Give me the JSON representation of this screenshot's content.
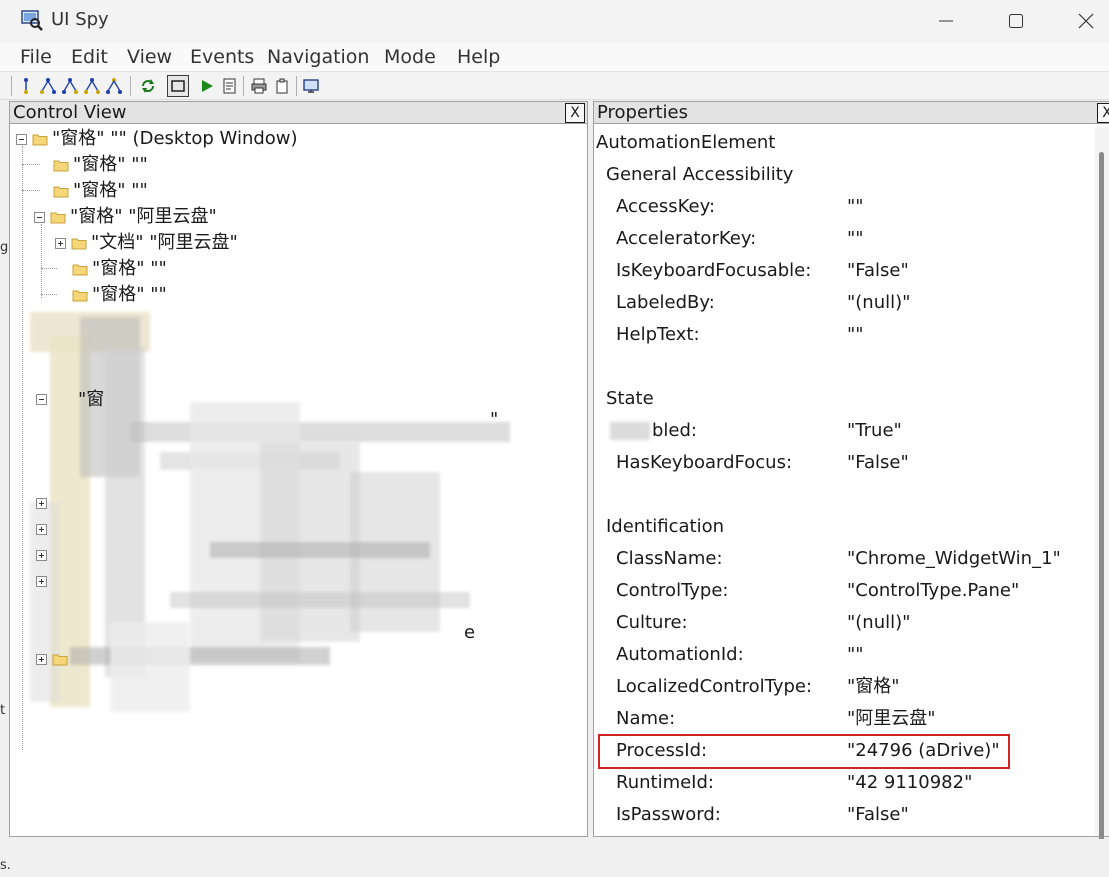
{
  "window": {
    "title": "UI Spy"
  },
  "menu": [
    "File",
    "Edit",
    "View",
    "Events",
    "Navigation",
    "Mode",
    "Help"
  ],
  "left_pane": {
    "title": "Control View",
    "close": "X",
    "tree": [
      {
        "text": "\"窗格\" \"\" (Desktop Window)"
      },
      {
        "text": "\"窗格\" \"\""
      },
      {
        "text": "\"窗格\" \"\""
      },
      {
        "text": "\"窗格\" \"阿里云盘\""
      },
      {
        "text": "\"文档\" \"阿里云盘\""
      },
      {
        "text": "\"窗格\" \"\""
      },
      {
        "text": "\"窗格\" \"\""
      }
    ],
    "obscured_fragment": "\"窗",
    "obscured_fragment2": "\"",
    "obscured_fragment3": "e"
  },
  "right_pane": {
    "title": "Properties",
    "close": "X",
    "root": "AutomationElement",
    "groups": [
      {
        "name": "General Accessibility",
        "props": [
          {
            "key": "AccessKey:",
            "value": "\"\""
          },
          {
            "key": "AcceleratorKey:",
            "value": "\"\""
          },
          {
            "key": "IsKeyboardFocusable:",
            "value": "\"False\""
          },
          {
            "key": "LabeledBy:",
            "value": "\"(null)\""
          },
          {
            "key": "HelpText:",
            "value": "\"\""
          }
        ]
      },
      {
        "name": "State",
        "props": [
          {
            "key": "bled:",
            "value": "\"True\""
          },
          {
            "key": "HasKeyboardFocus:",
            "value": "\"False\""
          }
        ]
      },
      {
        "name": "Identification",
        "props": [
          {
            "key": "ClassName:",
            "value": "\"Chrome_WidgetWin_1\""
          },
          {
            "key": "ControlType:",
            "value": "\"ControlType.Pane\""
          },
          {
            "key": "Culture:",
            "value": "\"(null)\""
          },
          {
            "key": "AutomationId:",
            "value": "\"\""
          },
          {
            "key": "LocalizedControlType:",
            "value": "\"窗格\""
          },
          {
            "key": "Name:",
            "value": "\"阿里云盘\""
          },
          {
            "key": "ProcessId:",
            "value": "\"24796 (aDrive)\""
          },
          {
            "key": "RuntimeId:",
            "value": "\"42 9110982\""
          },
          {
            "key": "IsPassword:",
            "value": "\"False\""
          }
        ]
      }
    ]
  },
  "edge_glyphs": [
    "g",
    "t",
    "s."
  ],
  "colors": {
    "highlight": "#d42323",
    "folder": "#f5d77a",
    "folder_edge": "#c9a23a"
  }
}
